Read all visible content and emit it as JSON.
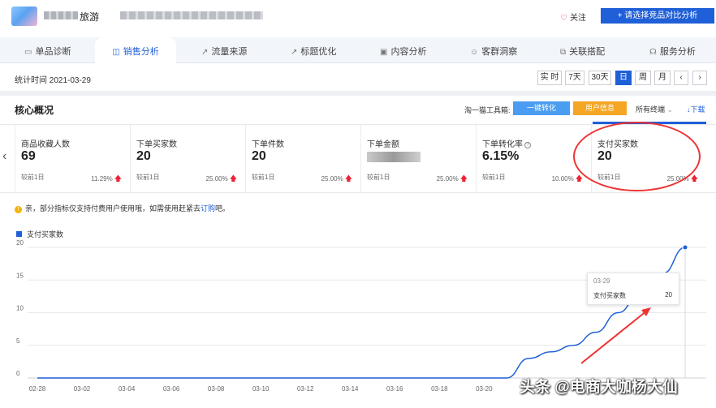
{
  "header": {
    "shop_name": "旅游",
    "follow_label": "关注",
    "compare_button": "+ 请选择竞品对比分析"
  },
  "tabs": [
    {
      "label": "单品诊断",
      "icon": "shop-icon"
    },
    {
      "label": "销售分析",
      "icon": "bag-icon",
      "active": true
    },
    {
      "label": "流量来源",
      "icon": "trend-icon"
    },
    {
      "label": "标题优化",
      "icon": "trend-icon"
    },
    {
      "label": "内容分析",
      "icon": "image-icon"
    },
    {
      "label": "客群洞察",
      "icon": "user-icon"
    },
    {
      "label": "关联搭配",
      "icon": "link-icon"
    },
    {
      "label": "服务分析",
      "icon": "headset-icon"
    }
  ],
  "stat": {
    "time_label": "统计时间 2021-03-29",
    "ranges": [
      "实 时",
      "7天",
      "30天",
      "日",
      "周",
      "月"
    ],
    "active_range": "日"
  },
  "core": {
    "title": "核心概况",
    "tools_label": "淘一猫工具箱:",
    "tool_one_click": "一键转化",
    "tool_user_info": "用户信息",
    "terminal": "所有终端",
    "download": "下载"
  },
  "metrics": [
    {
      "label": "商品收藏人数",
      "value": "69",
      "compare": "较前1日",
      "pct": "11.29%"
    },
    {
      "label": "下单买家数",
      "value": "20",
      "compare": "较前1日",
      "pct": "25.00%"
    },
    {
      "label": "下单件数",
      "value": "20",
      "compare": "较前1日",
      "pct": "25.00%"
    },
    {
      "label": "下单金额",
      "value": "",
      "compare": "较前1日",
      "pct": "25.00%"
    },
    {
      "label": "下单转化率",
      "value": "6.15%",
      "compare": "较前1日",
      "pct": "10.00%"
    },
    {
      "label": "支付买家数",
      "value": "20",
      "compare": "较前1日",
      "pct": "25.00%"
    }
  ],
  "notice": {
    "text": "亲，部分指标仅支持付费用户使用哦，如需使用赶紧去",
    "link": "订购",
    "suffix": "吧。"
  },
  "colors": {
    "accent": "#1f5fd8",
    "orange": "#f5a623",
    "light_blue": "#4a9df0",
    "up": "#e23333"
  },
  "chart_data": {
    "type": "line",
    "legend": "支付买家数",
    "x": [
      "02-28",
      "03-01",
      "03-02",
      "03-03",
      "03-04",
      "03-05",
      "03-06",
      "03-07",
      "03-08",
      "03-09",
      "03-10",
      "03-11",
      "03-12",
      "03-13",
      "03-14",
      "03-15",
      "03-16",
      "03-17",
      "03-18",
      "03-19",
      "03-20",
      "03-21",
      "03-22",
      "03-23",
      "03-24",
      "03-25",
      "03-26",
      "03-27",
      "03-28",
      "03-29"
    ],
    "x_tick_labels": [
      "02-28",
      "03-02",
      "03-04",
      "03-06",
      "03-08",
      "03-10",
      "03-12",
      "03-14",
      "03-16",
      "03-18",
      "03-20"
    ],
    "series": [
      {
        "name": "支付买家数",
        "values": [
          0,
          0,
          0,
          0,
          0,
          0,
          0,
          0,
          0,
          0,
          0,
          0,
          0,
          0,
          0,
          0,
          0,
          0,
          0,
          0,
          0,
          0,
          3,
          4,
          5,
          7,
          10,
          13,
          16,
          20
        ]
      }
    ],
    "y_ticks": [
      0,
      5,
      10,
      15,
      20
    ],
    "ylim": [
      0,
      20
    ],
    "grid": true,
    "tooltip": {
      "date": "03-29",
      "label": "支付买家数",
      "value": "20"
    }
  },
  "watermark": "头条 @电商大咖杨大仙"
}
